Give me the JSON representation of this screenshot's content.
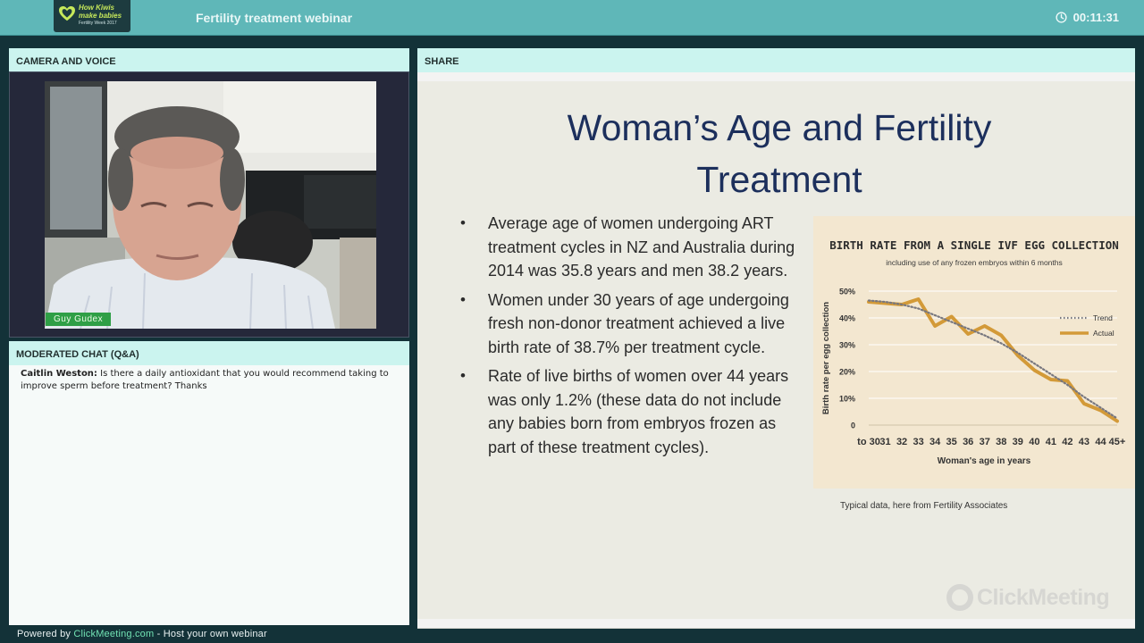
{
  "header": {
    "logo": {
      "line1": "How Kiwis",
      "line2": "make babies",
      "line3": "Fertility Week 2017"
    },
    "title": "Fertility treatment webinar",
    "timer": "00:11:31",
    "timer_icon": "clock-icon"
  },
  "camera": {
    "heading": "CAMERA AND VOICE",
    "presenter_name": "Guy Gudex"
  },
  "chat": {
    "heading": "MODERATED CHAT (Q&A)",
    "messages": [
      {
        "author": "Caitlin Weston:",
        "text": "Is there a daily antioxidant that you would recommend taking to improve sperm before treatment? Thanks"
      }
    ]
  },
  "footer": {
    "powered_prefix": "Powered by ",
    "powered_link": "ClickMeeting.com",
    "powered_suffix": " - Host your own webinar"
  },
  "share": {
    "heading": "SHARE",
    "slide": {
      "title_line1": "Woman’s Age and Fertility",
      "title_line2": "Treatment",
      "bullets": [
        "Average age of women undergoing ART treatment cycles in NZ and Australia during 2014 was 35.8 years and men 38.2 years.",
        "Women under 30 years of age undergoing fresh non-donor treatment achieved a live birth rate of 38.7% per treatment cycle.",
        "Rate of live births of women over 44 years was only 1.2% (these data do not include any babies born from embryos frozen as part of these treatment cycles)."
      ],
      "caption": "Typical data, here from Fertility Associates",
      "watermark": "ClickMeeting"
    }
  },
  "chart_data": {
    "type": "line",
    "title": "BIRTH RATE FROM A SINGLE IVF EGG COLLECTION",
    "subtitle": "including use of any frozen embryos within 6 months",
    "xlabel": "Woman's age in years",
    "ylabel": "Birth rate per egg collection",
    "categories": [
      "to 30",
      "31",
      "32",
      "33",
      "34",
      "35",
      "36",
      "37",
      "38",
      "39",
      "40",
      "41",
      "42",
      "43",
      "44",
      "45+"
    ],
    "ylim": [
      0,
      50
    ],
    "yticks": [
      "0",
      "10%",
      "20%",
      "30%",
      "40%",
      "50%"
    ],
    "grid": true,
    "legend_position": "top-right",
    "colors": {
      "actual": "#d39a38",
      "trend": "#77777f",
      "background": "#f3e7d0"
    },
    "series": [
      {
        "name": "Actual",
        "style": "solid",
        "values": [
          46,
          45.5,
          45,
          47,
          37,
          40.5,
          34,
          37,
          33.5,
          26,
          20.5,
          17,
          16.5,
          8,
          5.5,
          1.5
        ]
      },
      {
        "name": "Trend",
        "style": "dotted",
        "values": [
          46.5,
          46,
          45,
          43.5,
          41,
          38.5,
          36,
          33.5,
          30.5,
          27,
          23,
          19,
          15,
          10.5,
          6.5,
          2.5
        ]
      }
    ]
  }
}
